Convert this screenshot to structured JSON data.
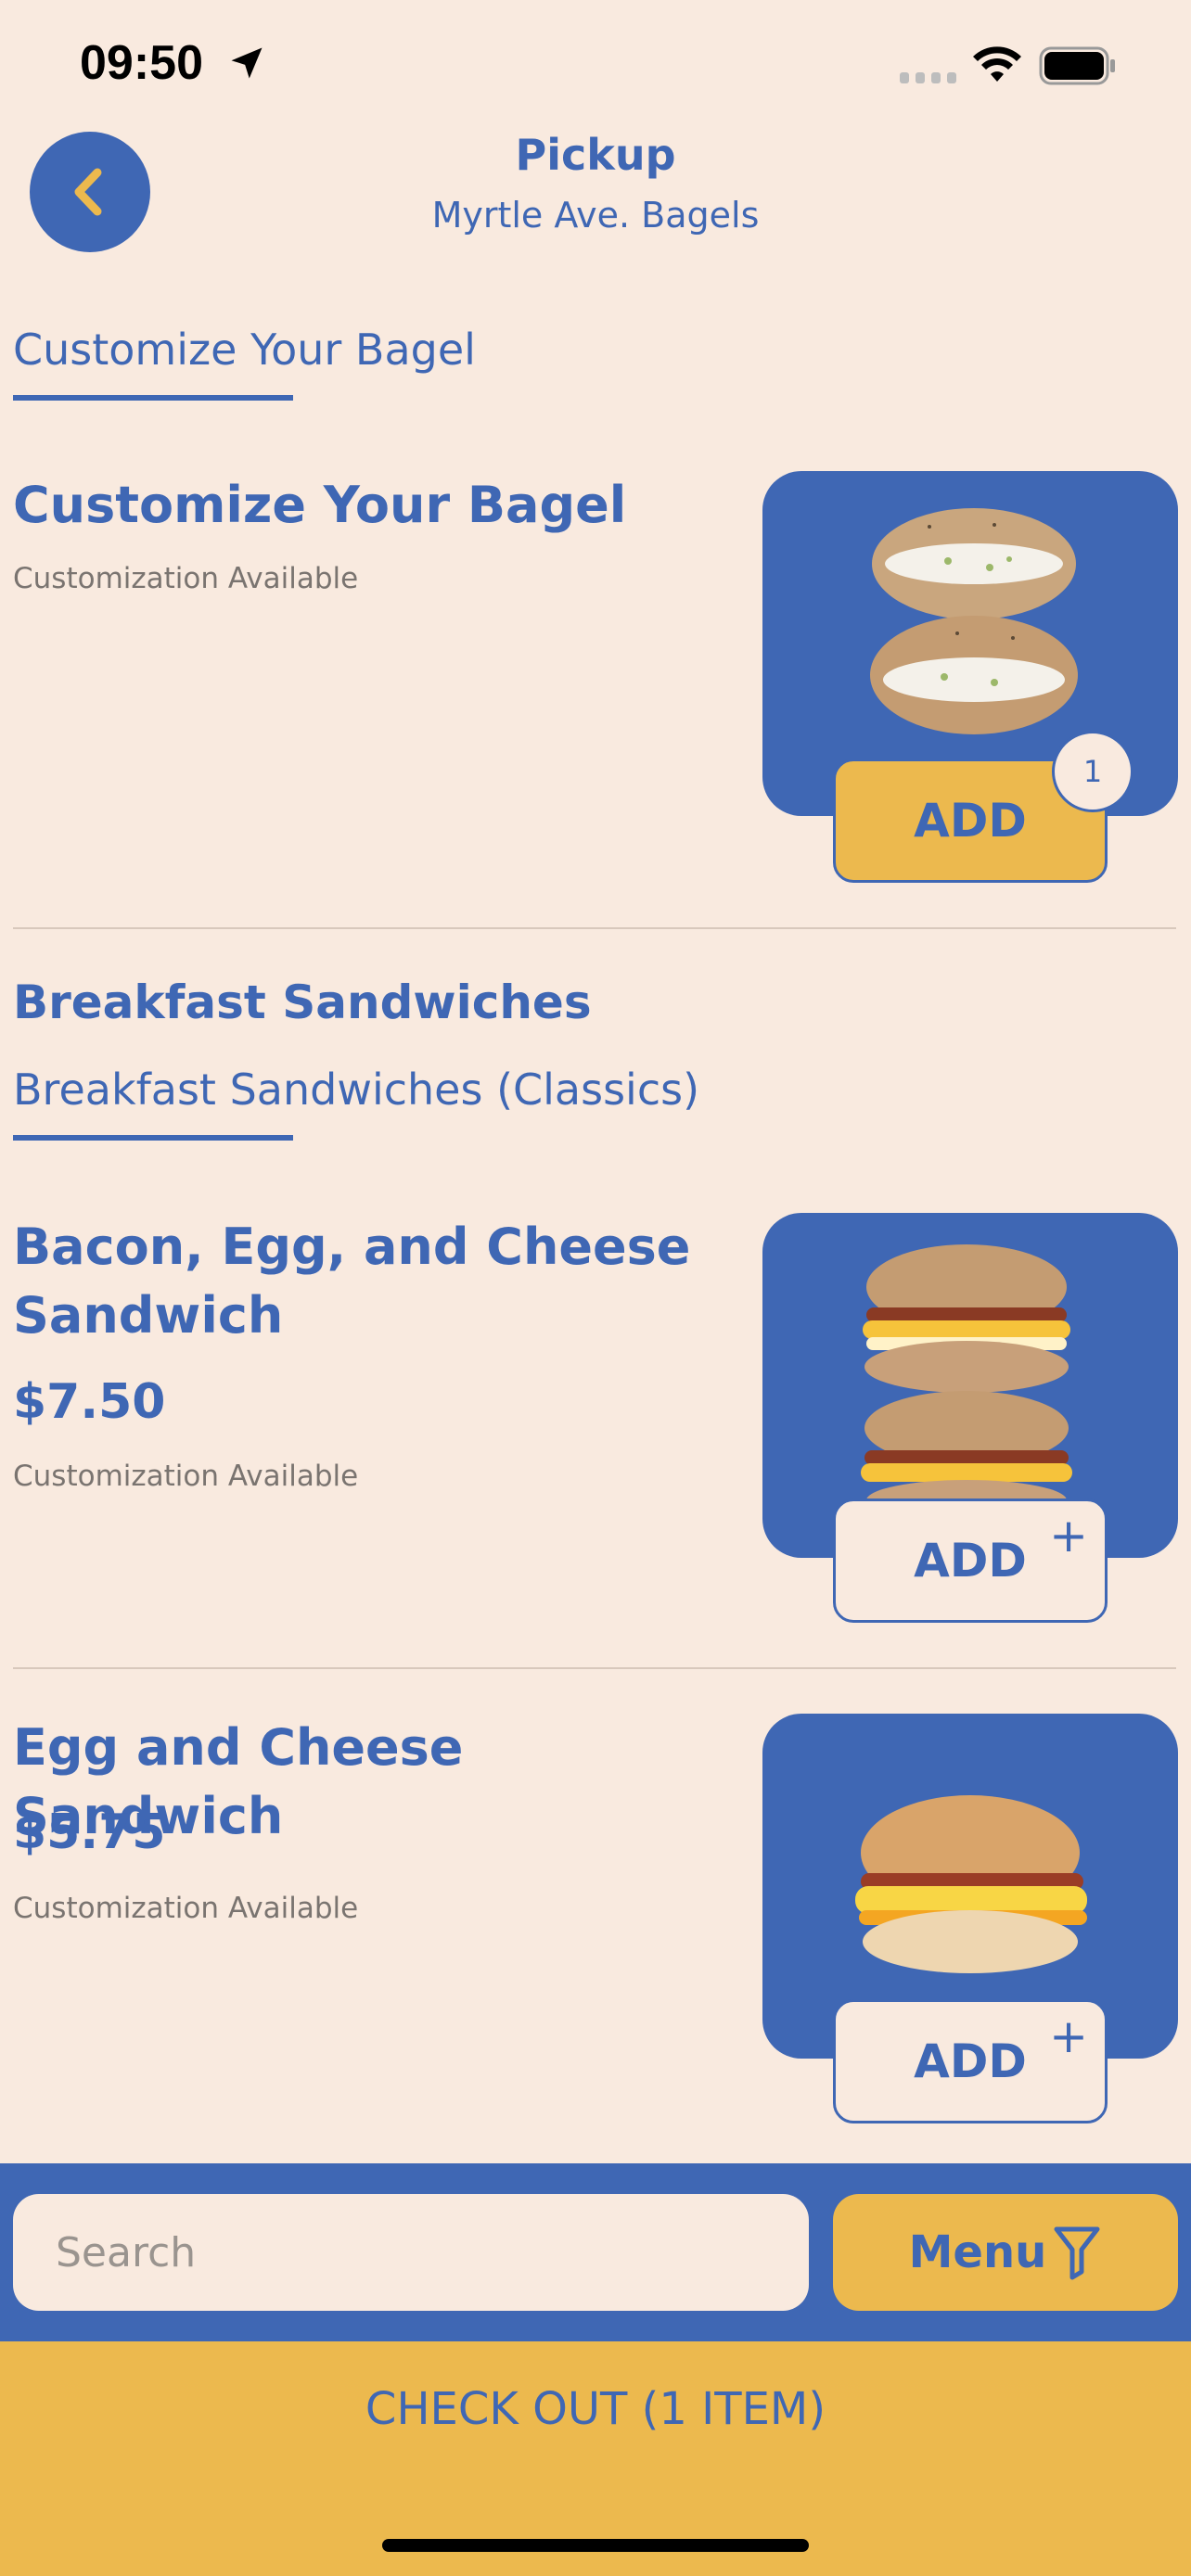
{
  "status_bar": {
    "time": "09:50"
  },
  "header": {
    "title": "Pickup",
    "subtitle": "Myrtle Ave. Bagels"
  },
  "tabs": {
    "customize": "Customize Your Bagel"
  },
  "item_customize": {
    "name": "Customize Your Bagel",
    "note": "Customization Available",
    "add_label": "ADD",
    "count": "1"
  },
  "section_breakfast": {
    "title": "Breakfast Sandwiches",
    "subtab": "Breakfast Sandwiches (Classics)"
  },
  "item_bec": {
    "name": "Bacon, Egg, and Cheese Sandwich",
    "price": "$7.50",
    "note": "Customization Available",
    "add_label": "ADD",
    "plus": "+"
  },
  "item_ec": {
    "name": "Egg and Cheese Sandwich",
    "price": "$5.75",
    "note": "Customization Available",
    "add_label": "ADD",
    "plus": "+"
  },
  "search": {
    "placeholder": "Search"
  },
  "menu_button": {
    "label": "Menu"
  },
  "checkout": {
    "label": "CHECK OUT (1 ITEM)"
  },
  "colors": {
    "brand_blue": "#3F67B4",
    "accent_yellow": "#ECB94E",
    "background": "#F9EADF"
  }
}
